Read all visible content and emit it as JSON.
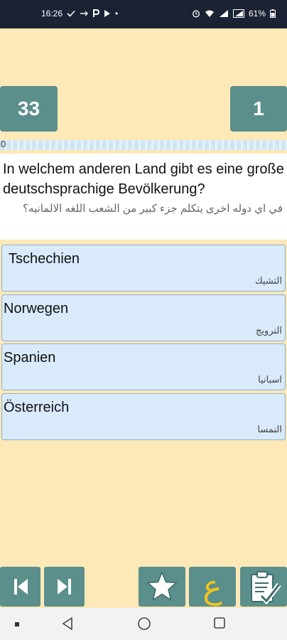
{
  "status_bar": {
    "time": "16:26",
    "battery": "61%"
  },
  "counters": {
    "left": "33",
    "right": "1"
  },
  "progress": {
    "label": "0",
    "value": 0
  },
  "question": {
    "german": "In welchem anderen Land gibt es eine große deutschsprachige Bevölkerung?",
    "arabic": "في اي دوله اخرى يتكلم جزء كبير من الشعب اللغه الالمانيه؟"
  },
  "answers": [
    {
      "german": "Tschechien",
      "arabic": "التشيك"
    },
    {
      "german": "Norwegen",
      "arabic": "النرويج"
    },
    {
      "german": "Spanien",
      "arabic": "اسبانيا"
    },
    {
      "german": "Österreich",
      "arabic": "النمسا"
    }
  ],
  "translate_button": {
    "glyph": "ع"
  },
  "colors": {
    "background": "#fde8b8",
    "button": "#5a8f8b",
    "answer_bg": "#d9eafb",
    "accent_yellow": "#f2c320"
  }
}
